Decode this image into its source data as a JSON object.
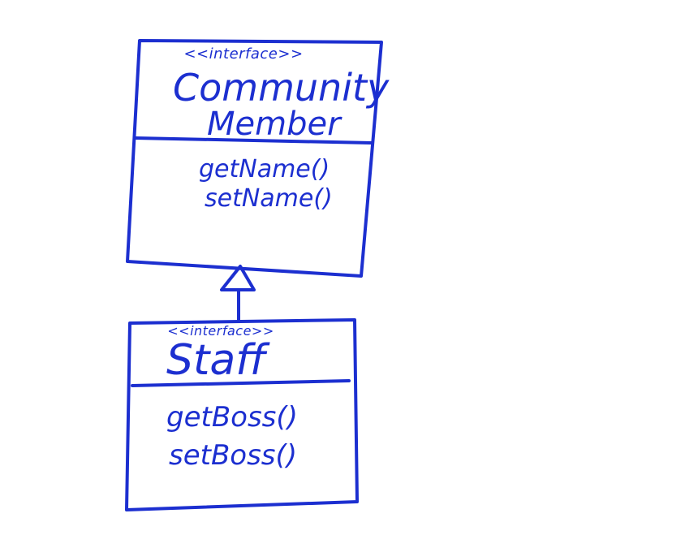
{
  "ink_color": "#1c2fd0",
  "community_member": {
    "stereotype": "<<interface>>",
    "name_line1": "Community",
    "name_line2": "Member",
    "methods": [
      "getName()",
      "setName()"
    ]
  },
  "staff": {
    "stereotype": "<<interface>>",
    "name": "Staff",
    "methods": [
      "getBoss()",
      "setBoss()"
    ]
  },
  "relationship": "generalization"
}
